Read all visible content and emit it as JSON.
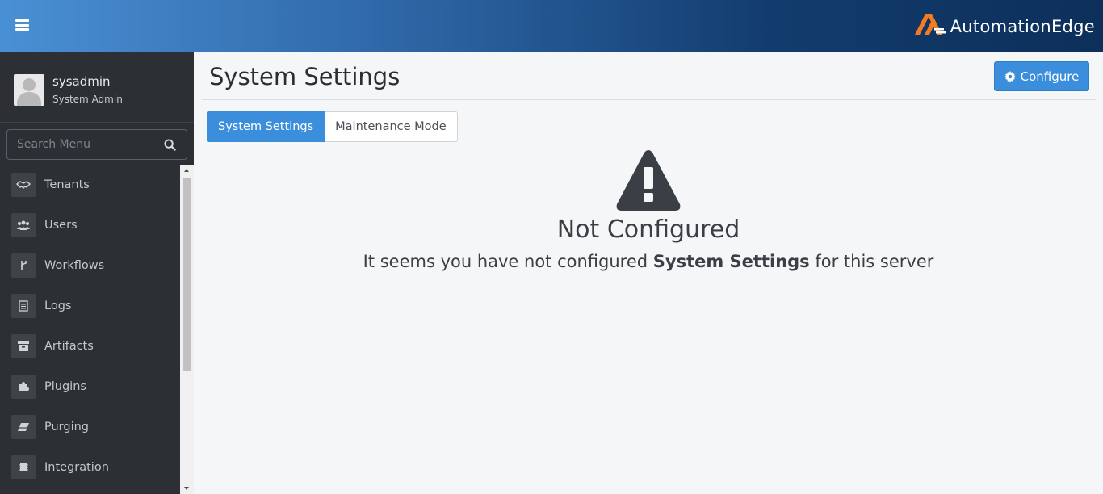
{
  "header": {
    "brand": "AutomationEdge",
    "brand_accent": "#f47b20",
    "menu_icon": "hamburger-icon"
  },
  "user": {
    "name": "sysadmin",
    "role": "System Admin"
  },
  "search": {
    "placeholder": "Search Menu",
    "value": ""
  },
  "sidebar": {
    "items": [
      {
        "label": "Tenants",
        "icon": "handshake-icon"
      },
      {
        "label": "Users",
        "icon": "users-icon"
      },
      {
        "label": "Workflows",
        "icon": "branch-icon"
      },
      {
        "label": "Logs",
        "icon": "file-text-icon"
      },
      {
        "label": "Artifacts",
        "icon": "archive-icon"
      },
      {
        "label": "Plugins",
        "icon": "puzzle-icon"
      },
      {
        "label": "Purging",
        "icon": "eraser-icon"
      },
      {
        "label": "Integration",
        "icon": "chip-icon"
      }
    ]
  },
  "main": {
    "title": "System Settings",
    "configure_label": "Configure",
    "tabs": [
      {
        "label": "System Settings",
        "active": true
      },
      {
        "label": "Maintenance Mode",
        "active": false
      }
    ],
    "empty_state": {
      "icon": "warning-icon",
      "title": "Not Configured",
      "message_prefix": "It seems you have not configured ",
      "message_bold": "System Settings",
      "message_suffix": " for this server"
    }
  },
  "colors": {
    "primary": "#3a8edb",
    "sidebar_bg": "#2c3034",
    "header_gradient_start": "#4a90d4",
    "header_gradient_end": "#0d2f5a"
  }
}
